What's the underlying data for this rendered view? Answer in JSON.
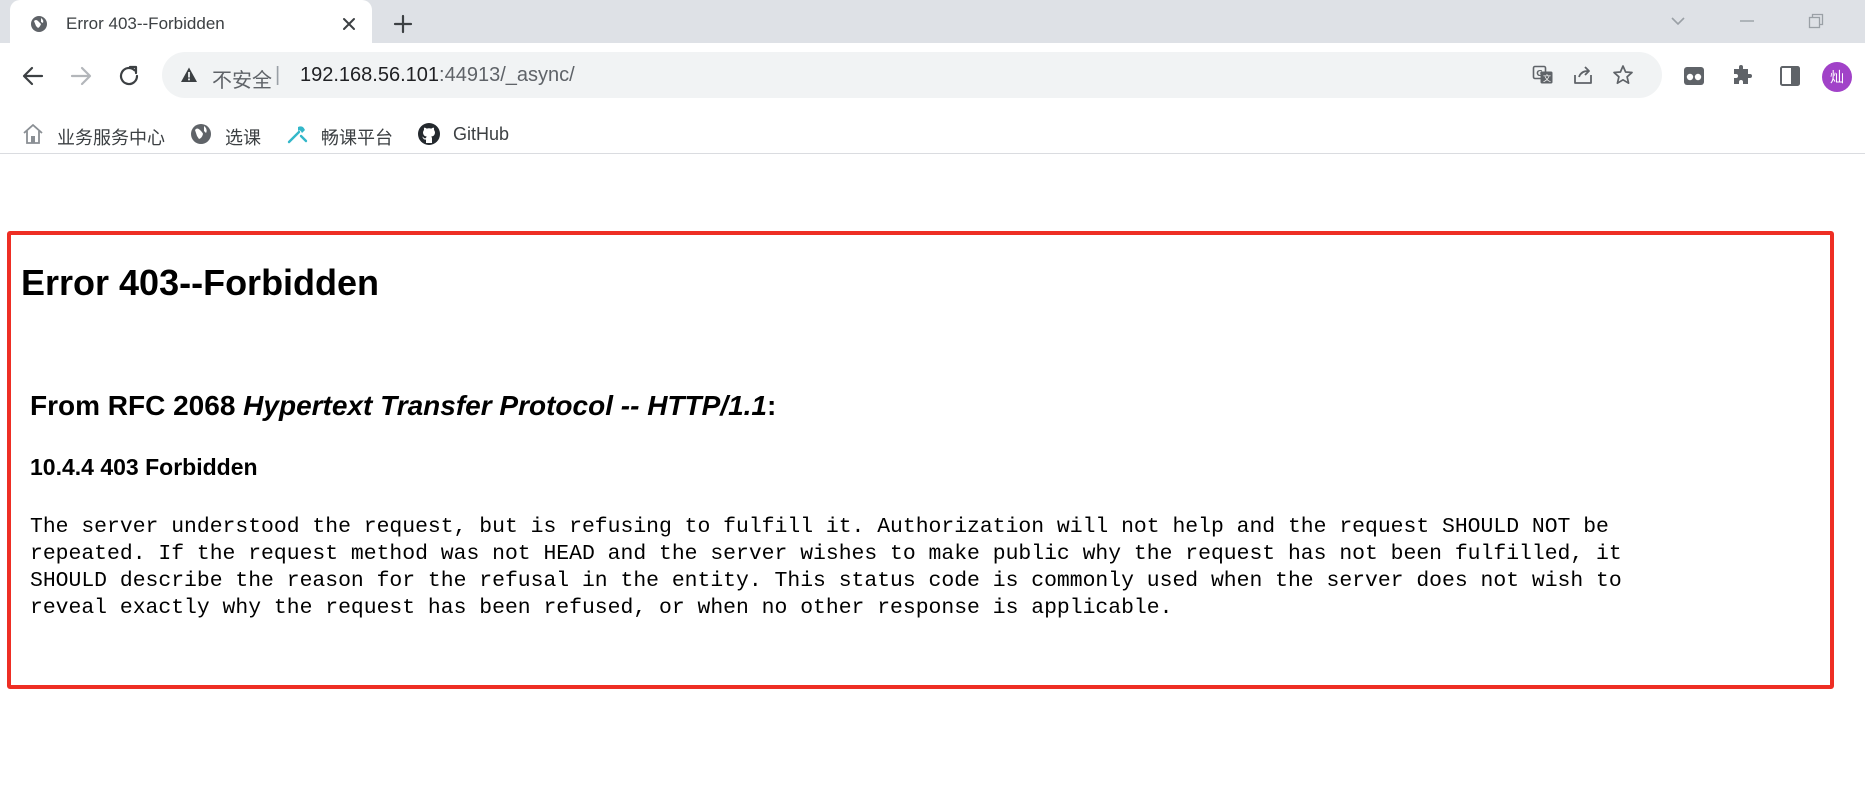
{
  "browser": {
    "tab": {
      "title": "Error 403--Forbidden",
      "favicon": "globe-icon"
    },
    "window_controls": [
      "chevron-down-icon",
      "minimize-icon",
      "restore-icon"
    ],
    "address_bar": {
      "security_label": "不安全",
      "divider": "|",
      "url_host": "192.168.56.101",
      "url_rest": ":44913/_async/"
    },
    "toolbar_icons": [
      "translate-icon",
      "share-icon",
      "star-icon",
      "tab-search-icon",
      "extensions-icon",
      "side-panel-icon"
    ],
    "profile_avatar": "灿",
    "bookmarks": [
      {
        "label": "业务服务中心",
        "icon": "home-icon"
      },
      {
        "label": "选课",
        "icon": "globe-icon"
      },
      {
        "label": "畅课平台",
        "icon": "tool-icon"
      },
      {
        "label": "GitHub",
        "icon": "github-icon"
      }
    ]
  },
  "page": {
    "heading": "Error 403--Forbidden",
    "rfc_prefix": "From RFC 2068 ",
    "rfc_title": "Hypertext Transfer Protocol -- HTTP/1.1",
    "rfc_suffix": ":",
    "section_heading": "10.4.4 403 Forbidden",
    "body_lines": [
      "The server understood the request, but is refusing to fulfill it. Authorization will not help and the request SHOULD NOT be",
      "repeated. If the request method was not HEAD and the server wishes to make public why the request has not been fulfilled, it",
      "SHOULD describe the reason for the refusal in the entity. This status code is commonly used when the server does not wish to",
      "reveal exactly why the request has been refused, or when no other response is applicable."
    ]
  },
  "colors": {
    "highlight_border": "#ee2e24",
    "tabstrip_bg": "#dee1e6",
    "omnibox_bg": "#f1f3f4",
    "avatar_bg": "#a142c8"
  }
}
